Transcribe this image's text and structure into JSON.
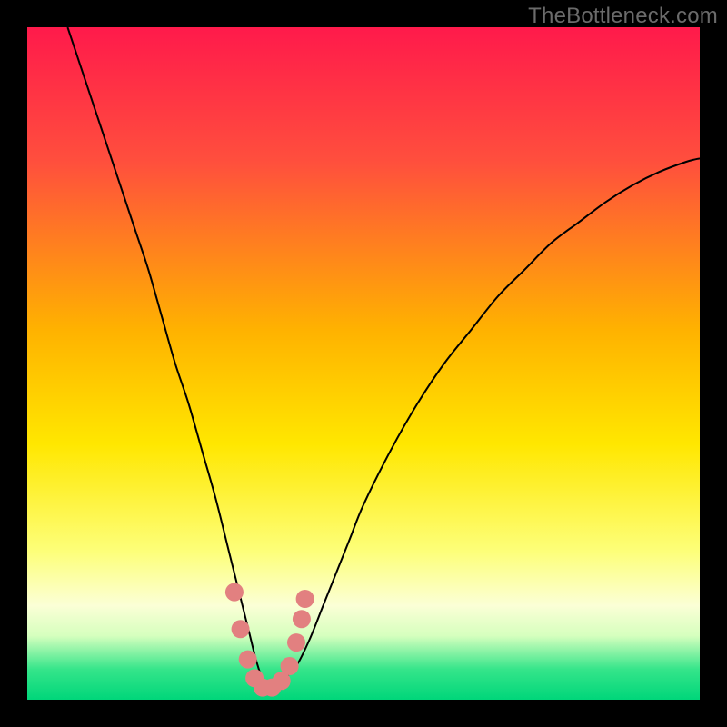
{
  "watermark": "TheBottleneck.com",
  "chart_data": {
    "type": "line",
    "title": "",
    "xlabel": "",
    "ylabel": "",
    "xlim": [
      0,
      100
    ],
    "ylim": [
      0,
      100
    ],
    "grid": false,
    "legend": false,
    "background_gradient": {
      "stops": [
        {
          "offset": 0.0,
          "color": "#ff1a4b"
        },
        {
          "offset": 0.2,
          "color": "#ff4f3d"
        },
        {
          "offset": 0.45,
          "color": "#ffb200"
        },
        {
          "offset": 0.62,
          "color": "#ffe700"
        },
        {
          "offset": 0.78,
          "color": "#fdff7a"
        },
        {
          "offset": 0.86,
          "color": "#fbffd6"
        },
        {
          "offset": 0.905,
          "color": "#d6ffbe"
        },
        {
          "offset": 0.955,
          "color": "#35e58a"
        },
        {
          "offset": 1.0,
          "color": "#00d67a"
        }
      ]
    },
    "series": [
      {
        "name": "bottleneck-curve",
        "color": "#000000",
        "stroke_width": 2,
        "x": [
          6,
          8,
          10,
          12,
          14,
          16,
          18,
          20,
          22,
          24,
          26,
          28,
          30,
          31,
          32,
          33,
          34,
          35,
          36,
          37,
          38,
          40,
          42,
          44,
          46,
          48,
          50,
          54,
          58,
          62,
          66,
          70,
          74,
          78,
          82,
          86,
          90,
          94,
          98,
          100
        ],
        "y": [
          100,
          94,
          88,
          82,
          76,
          70,
          64,
          57,
          50,
          44,
          37,
          30,
          22,
          18,
          14,
          10,
          6,
          3,
          2,
          2,
          3,
          5,
          9,
          14,
          19,
          24,
          29,
          37,
          44,
          50,
          55,
          60,
          64,
          68,
          71,
          74,
          76.5,
          78.5,
          80,
          80.5
        ]
      }
    ],
    "markers": {
      "name": "highlight-dots",
      "color": "#e28080",
      "radius": 10,
      "x": [
        30.8,
        31.7,
        32.8,
        33.8,
        35.0,
        36.4,
        37.8,
        39.0,
        40.0,
        40.8,
        41.3
      ],
      "y": [
        16.0,
        10.5,
        6.0,
        3.2,
        1.8,
        1.8,
        2.8,
        5.0,
        8.5,
        12.0,
        15.0
      ]
    }
  }
}
